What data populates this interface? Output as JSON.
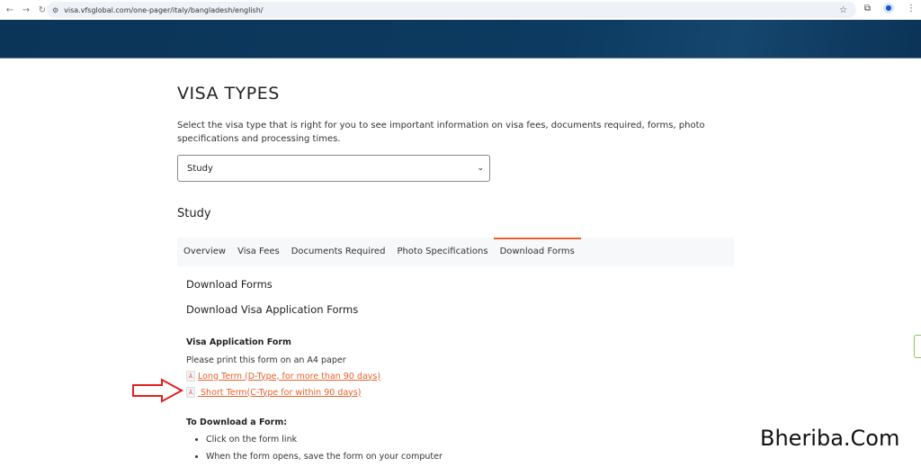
{
  "browser": {
    "url": "visa.vfsglobal.com/one-pager/italy/bangladesh/english/"
  },
  "page": {
    "title": "VISA TYPES",
    "intro": "Select the visa type that is right for you to see important information on visa fees, documents required, forms, photo specifications and processing times.",
    "visa_select": {
      "value": "Study"
    },
    "section_title": "Study",
    "tabs": [
      {
        "label": "Overview"
      },
      {
        "label": "Visa Fees"
      },
      {
        "label": "Documents Required"
      },
      {
        "label": "Photo Specifications"
      },
      {
        "label": "Download Forms",
        "active": true
      }
    ],
    "content": {
      "heading1": "Download Forms",
      "heading2": "Download Visa Application Forms",
      "form_title": "Visa Application Form",
      "form_note": "Please print this form on an A4 paper",
      "links": [
        {
          "label": "Long Term (D-Type, for more than 90 days)",
          "icon": "pdf-icon"
        },
        {
          "label": " Short Term(C-Type for within 90 days)",
          "icon": "pdf-icon"
        }
      ],
      "instructions_title": "To Download a Form:",
      "steps": [
        "Click on the form link",
        "When the form opens, save the form on your computer"
      ]
    }
  },
  "watermark": "Bheriba.Com",
  "colors": {
    "accent": "#e8612c",
    "banner": "#0b3558",
    "arrow": "#e02020"
  }
}
